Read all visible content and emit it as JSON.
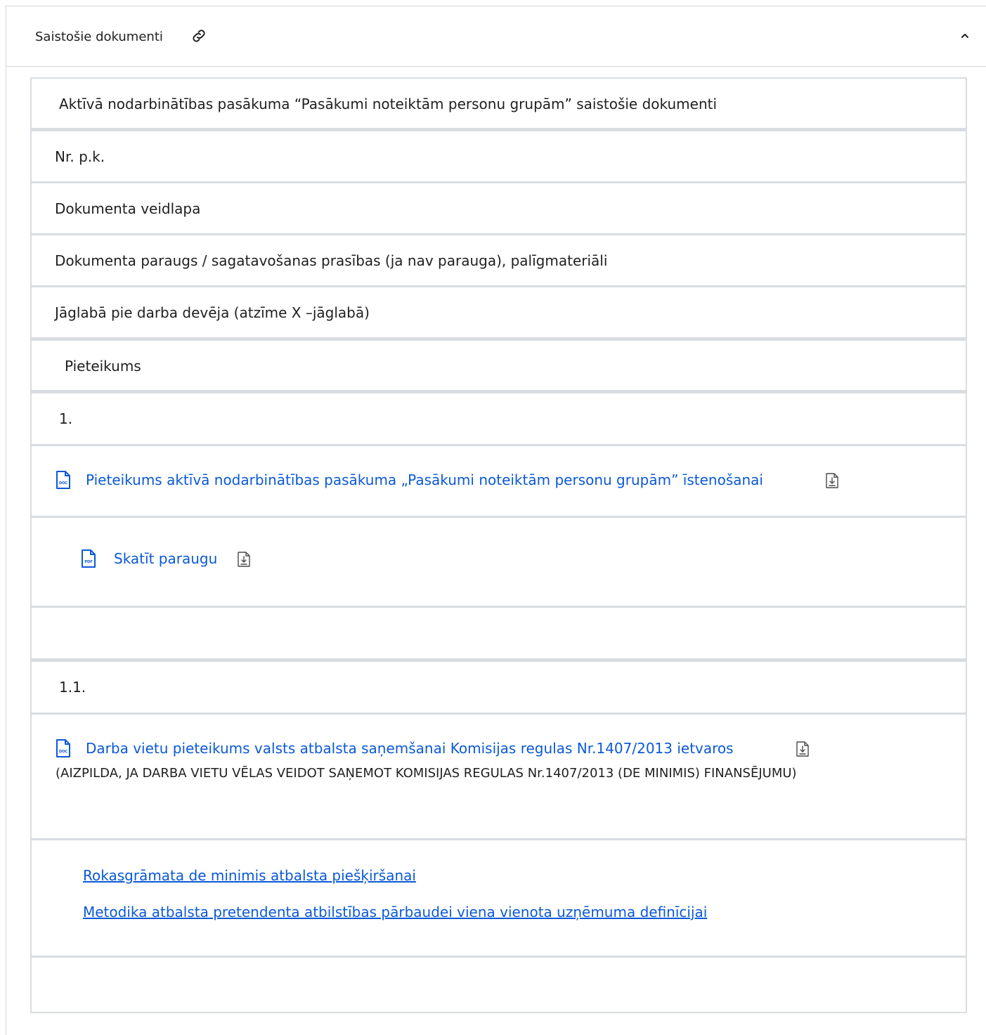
{
  "accordion": {
    "title": "Saistošie dokumenti",
    "link_icon": "link-icon",
    "chevron_icon": "chevron-up-icon"
  },
  "table": {
    "caption": "Aktīvā nodarbinātības pasākuma “Pasākumi noteiktām personu grupām” saistošie dokumenti",
    "headers": [
      "Nr. p.k.",
      "Dokumenta veidlapa",
      "Dokumenta paraugs / sagatavošanas prasības (ja nav parauga), palīgmateriāli",
      "Jāglabā pie darba devēja (atzīme X –jāglabā)"
    ],
    "section_title": "Pieteikums",
    "rows": [
      {
        "number": "1.",
        "form": {
          "label": "Pieteikums aktīvā nodarbinātības pasākuma „Pasākumi noteiktām personu grupām” īstenošanai",
          "file_type": "DOC",
          "icon": "download-icon"
        },
        "sample": {
          "label": "Skatīt paraugu",
          "file_type": "PDF",
          "icon": "download-icon"
        },
        "keep": ""
      },
      {
        "number": "1.1.",
        "form": {
          "label": "Darba vietu pieteikums valsts atbalsta saņemšanai Komisijas regulas Nr.1407/2013 ietvaros",
          "file_type": "DOC",
          "icon": "download-icon",
          "note": "(AIZPILDA, JA DARBA VIETU VĒLAS VEIDOT SAŅEMOT KOMISIJAS REGULAS Nr.1407/2013 (DE MINIMIS) FINANSĒJUMU)"
        },
        "sample_links": [
          "Rokasgrāmata de minimis atbalsta piešķiršanai",
          "Metodika atbalsta pretendenta atbilstības pārbaudei viena vienota uzņēmuma definīcijai"
        ],
        "keep": ""
      }
    ]
  },
  "colors": {
    "link": "#0b59d6",
    "border": "#d9dde1",
    "text": "#1f1f1f"
  }
}
